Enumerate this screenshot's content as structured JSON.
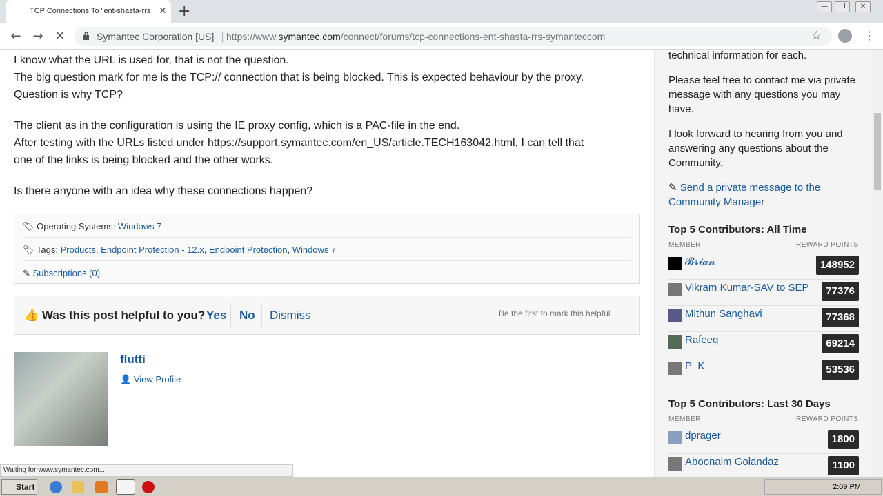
{
  "browser": {
    "tab_title": "TCP Connections To \"ent-shasta-rrs",
    "tab_close": "✕",
    "new_tab": "+",
    "security_label": "Symantec Corporation [US]",
    "url_scheme": "https://www.",
    "url_host": "symantec.com",
    "url_path": "/connect/forums/tcp-connections-ent-shasta-rrs-symanteccom"
  },
  "post": {
    "paragraphs": [
      "I know what the URL is used for, that is not the question.",
      "The big question mark for me is the TCP:// connection that is being blocked. This is expected behaviour by the proxy.",
      "Question is why TCP?",
      "The client as in the configuration is using the IE proxy config, which is a PAC-file in the end.",
      "After testing with the URLs listed under https://support.symantec.com/en_US/article.TECH163042.html, I can tell that",
      "one of the links is being blocked and the other works.",
      "Is there anyone with an idea why these connections happen?"
    ],
    "os_label": "Operating Systems:",
    "os_value": "Windows 7",
    "tags_label": "Tags:",
    "tags": [
      "Products",
      "Endpoint Protection - 12.x",
      "Endpoint Protection",
      "Windows 7"
    ],
    "subscriptions": "Subscriptions (0)"
  },
  "helpful": {
    "question": "Was this post helpful to you?",
    "yes": "Yes",
    "no": "No",
    "dismiss": "Dismiss",
    "hint": "Be the first to mark this helpful."
  },
  "author": {
    "name": "flutti",
    "view_profile": "View Profile"
  },
  "status_text": "Waiting for www.symantec.com...",
  "sidebar": {
    "p1": "technical information for each.",
    "p2": "Please feel free to contact me via private message with any questions you may have.",
    "p3": "I look forward to hearing from you and answering any questions about the Community.",
    "send_pm": "Send a private message to the Community Manager",
    "all_time_title": "Top 5 Contributors: All Time",
    "last30_title": "Top 5 Contributors: Last 30 Days",
    "member_hdr": "MEMBER",
    "points_hdr": "REWARD POINTS",
    "all_time": [
      {
        "name": "𝓑𝓻𝓲𝓪𝓷",
        "points": "148952"
      },
      {
        "name": "Vikram Kumar-SAV to SEP",
        "points": "77376"
      },
      {
        "name": "Mithun Sanghavi",
        "points": "77368"
      },
      {
        "name": "Rafeeq",
        "points": "69214"
      },
      {
        "name": "P_K_",
        "points": "53536"
      }
    ],
    "last30": [
      {
        "name": "dprager",
        "points": "1800"
      },
      {
        "name": "Aboonaim Golandaz",
        "points": "1100"
      }
    ]
  },
  "taskbar": {
    "start": "Start",
    "clock": "2:09 PM"
  },
  "colors": {
    "link": "#1a5a9a",
    "points_bg": "#2a2a2a"
  }
}
